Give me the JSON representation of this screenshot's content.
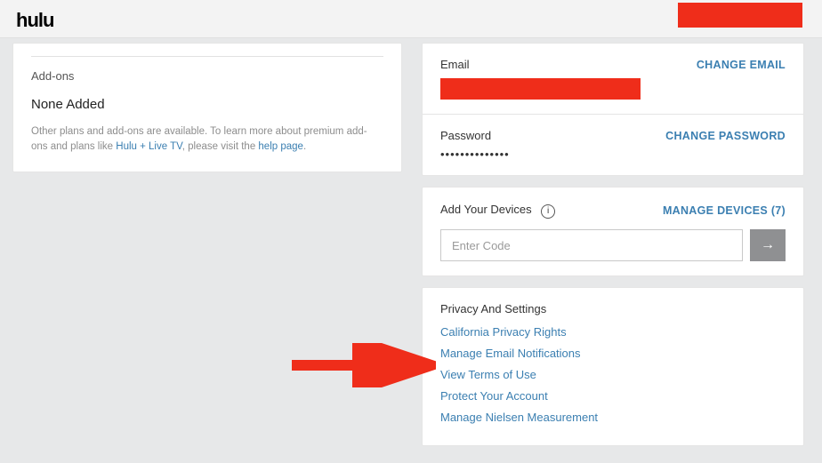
{
  "brand": "hulu",
  "left": {
    "addons_label": "Add-ons",
    "none_added": "None Added",
    "desc_prefix": "Other plans and add-ons are available. To learn more about premium add-ons and plans like ",
    "link1": "Hulu + Live TV",
    "desc_mid": ", please visit the ",
    "link2": "help page",
    "desc_suffix": "."
  },
  "email": {
    "label": "Email",
    "action": "CHANGE EMAIL"
  },
  "password": {
    "label": "Password",
    "action": "CHANGE PASSWORD",
    "mask": "••••••••••••••"
  },
  "devices": {
    "label": "Add Your Devices",
    "action": "MANAGE DEVICES (7)",
    "placeholder": "Enter Code",
    "submit_glyph": "→"
  },
  "privacy": {
    "title": "Privacy And Settings",
    "links": [
      "California Privacy Rights",
      "Manage Email Notifications",
      "View Terms of Use",
      "Protect Your Account",
      "Manage Nielsen Measurement"
    ]
  }
}
